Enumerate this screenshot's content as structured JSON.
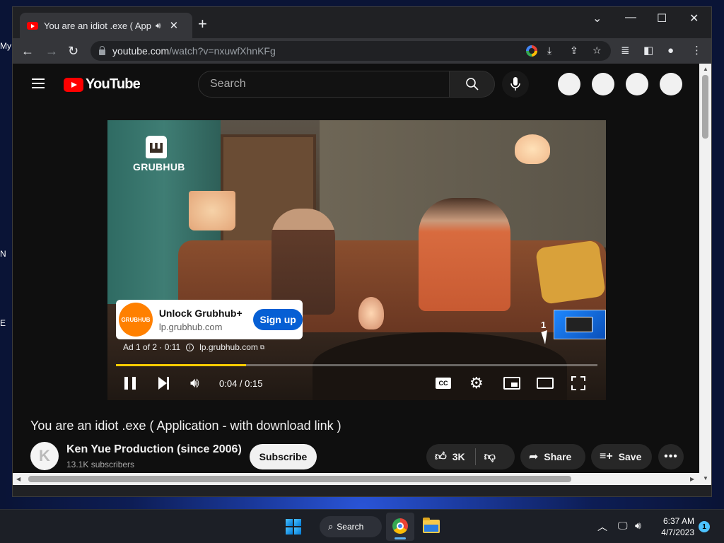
{
  "desktop": {
    "icon_labels": [
      "My",
      "N",
      "E"
    ]
  },
  "browser": {
    "tab": {
      "title": "You are an idiot .exe ( Application - with download link )",
      "audio_icon": "speaker-icon",
      "close_glyph": "✕"
    },
    "new_tab_glyph": "+",
    "window_controls": [
      "⌄",
      "—",
      "☐",
      "✕"
    ],
    "nav": {
      "back": "←",
      "forward": "→",
      "reload": "↻"
    },
    "url": {
      "host": "youtube.com",
      "path": "/watch?v=nxuwfXhnKFg"
    }
  },
  "youtube": {
    "logo_text": "YouTube",
    "search_placeholder": "Search",
    "player": {
      "brand": "GRUBHUB",
      "ad_card": {
        "avatar_text": "GRUBHUB",
        "title": "Unlock Grubhub+",
        "domain": "lp.grubhub.com",
        "cta": "Sign up"
      },
      "ad_info": {
        "position": "Ad 1 of 2 · 0:11",
        "domain": "lp.grubhub.com"
      },
      "up_next_count": "1",
      "progress_fraction": 0.27,
      "time": "0:04 / 0:15",
      "cc_label": "CC"
    },
    "video": {
      "title": "You are an idiot .exe ( Application - with download link )",
      "channel": "Ken Yue Production (since 2006)",
      "subscribers": "13.1K subscribers",
      "subscribe_label": "Subscribe",
      "likes": "3K",
      "share_label": "Share",
      "save_label": "Save",
      "more_glyph": "•••"
    }
  },
  "taskbar": {
    "search_label": "Search",
    "time": "6:37 AM",
    "date": "4/7/2023",
    "notification_count": "1"
  },
  "colors": {
    "youtube_red": "#ff0000",
    "progress_ad_yellow": "#ffcc00",
    "signup_blue": "#065fd4",
    "grubhub_orange": "#ff8000"
  }
}
